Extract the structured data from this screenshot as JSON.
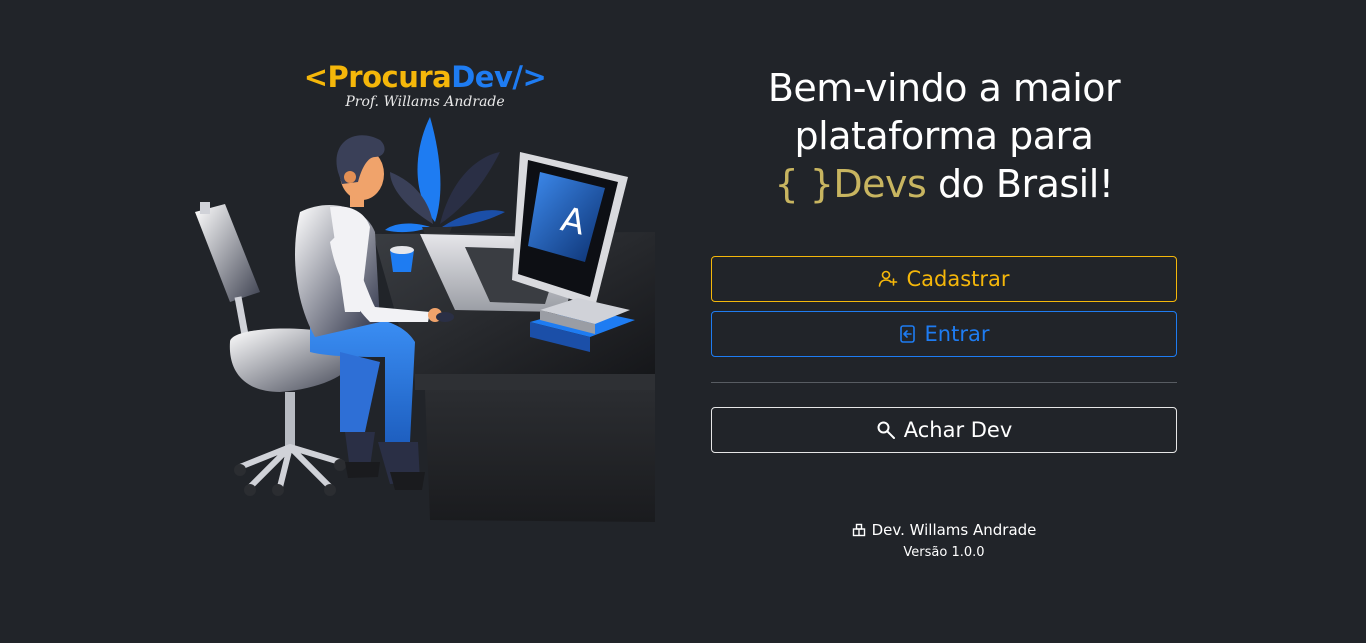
{
  "brand": {
    "open": "<",
    "name_part1": "Procura",
    "name_part2": "Dev",
    "close": "/>",
    "subtitle": "Prof. Willams Andrade"
  },
  "welcome": {
    "line1": "Bem-vindo a maior",
    "line2": "plataforma para",
    "braces": "{ }",
    "devs": "Devs",
    "line3_rest": " do Brasil!"
  },
  "actions": {
    "signup_label": "Cadastrar",
    "login_label": "Entrar",
    "find_dev_label": "Achar Dev"
  },
  "footer": {
    "developer": "Dev. Willams Andrade",
    "version": "Versão 1.0.0"
  },
  "icons": {
    "signup": "user-plus-icon",
    "login": "login-icon",
    "find": "search-icon",
    "developer": "building-icon"
  },
  "colors": {
    "background": "#212429",
    "accent_yellow": "#f5b70a",
    "accent_blue": "#1e7cf2",
    "accent_gold": "#c8b560"
  }
}
